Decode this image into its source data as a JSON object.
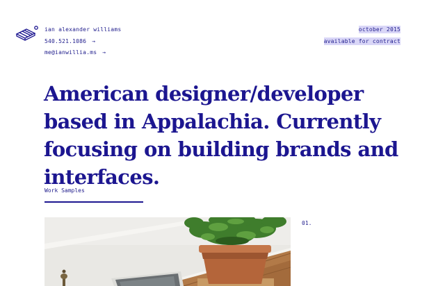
{
  "header": {
    "logo_icon": "stacked-boxes-logo-icon",
    "contact": {
      "name": "ian alexander williams",
      "phone": "540.521.1086",
      "phone_arrow": "→",
      "email": "me@ianwillia.ms",
      "email_arrow": "→"
    },
    "meta": {
      "date": "october 2015",
      "status": "available for contract",
      "highlight_color": "#d9d6f7"
    }
  },
  "hero": {
    "headline": "American designer/developer based in Appalachia. Currently focusing on building brands and interfaces."
  },
  "work": {
    "section_label": "Work Samples",
    "samples": [
      {
        "number": "01."
      }
    ]
  },
  "colors": {
    "accent": "#1c1690",
    "background": "#ffffff"
  }
}
